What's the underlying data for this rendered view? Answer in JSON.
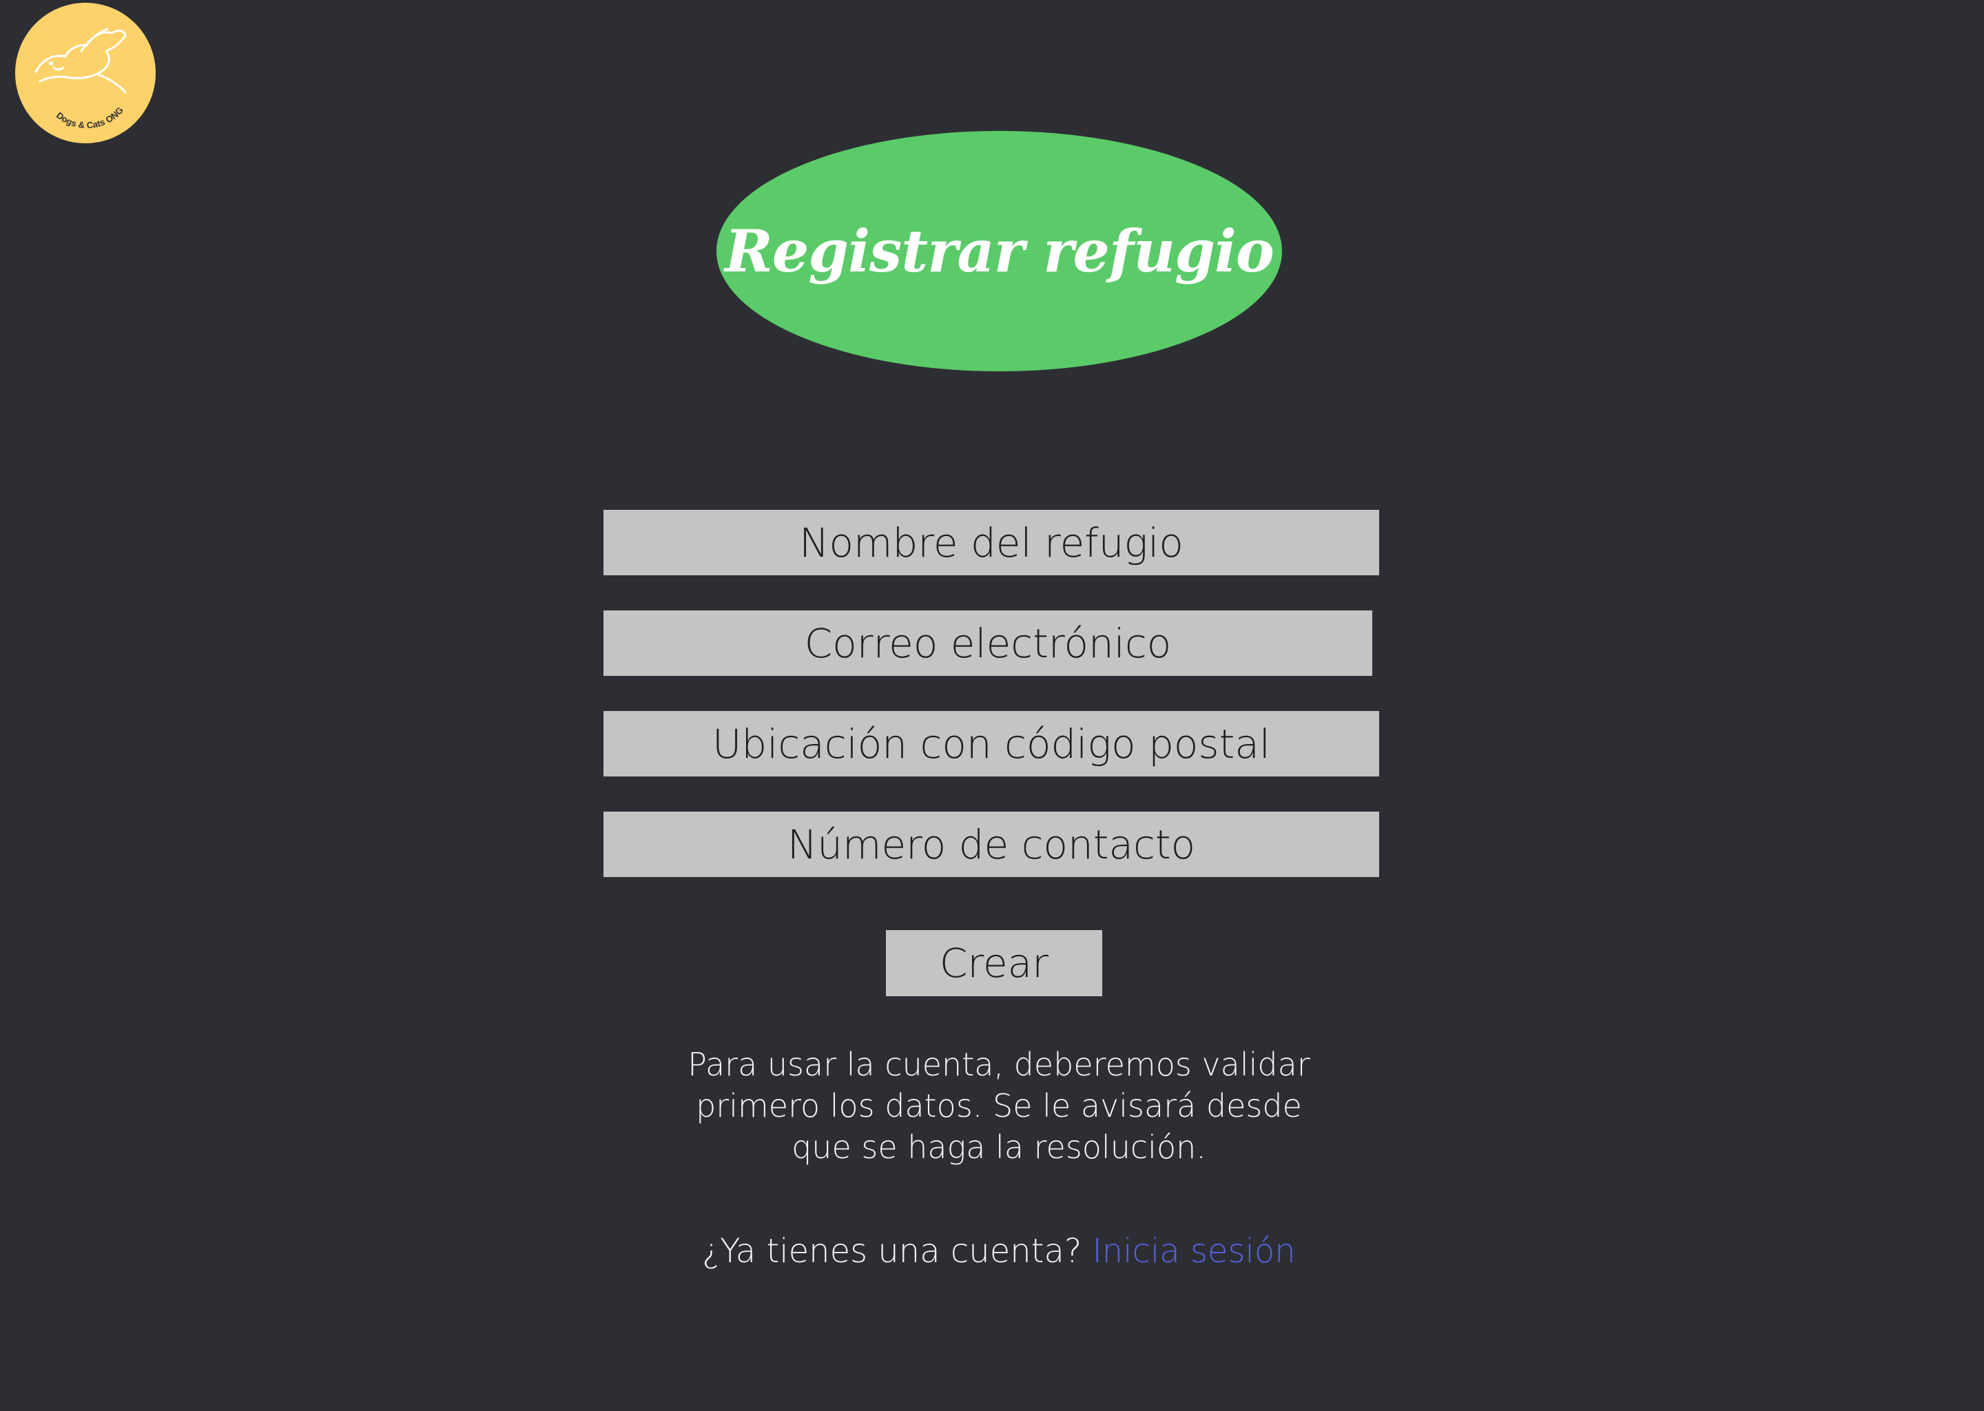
{
  "brand": {
    "logo_text": "Dogs & Cats ONG",
    "logo_color": "#fed26b"
  },
  "header": {
    "title": "Registrar refugio",
    "title_bg_color": "#5bcb69"
  },
  "form": {
    "fields": [
      {
        "placeholder": "Nombre del refugio",
        "value": ""
      },
      {
        "placeholder": "Correo electrónico",
        "value": ""
      },
      {
        "placeholder": "Ubicación con código postal",
        "value": ""
      },
      {
        "placeholder": "Número de contacto",
        "value": ""
      }
    ],
    "submit_label": "Crear"
  },
  "notice": {
    "lines": [
      "Para usar la cuenta, deberemos validar",
      "primero los datos. Se le avisará desde",
      "que se haga la resolución."
    ]
  },
  "login": {
    "prompt": "¿Ya tienes una cuenta?",
    "link_label": "Inicia sesión",
    "link_color": "#5662e0"
  },
  "colors": {
    "background": "#2d2e33",
    "field_bg": "#c4c4c4"
  }
}
